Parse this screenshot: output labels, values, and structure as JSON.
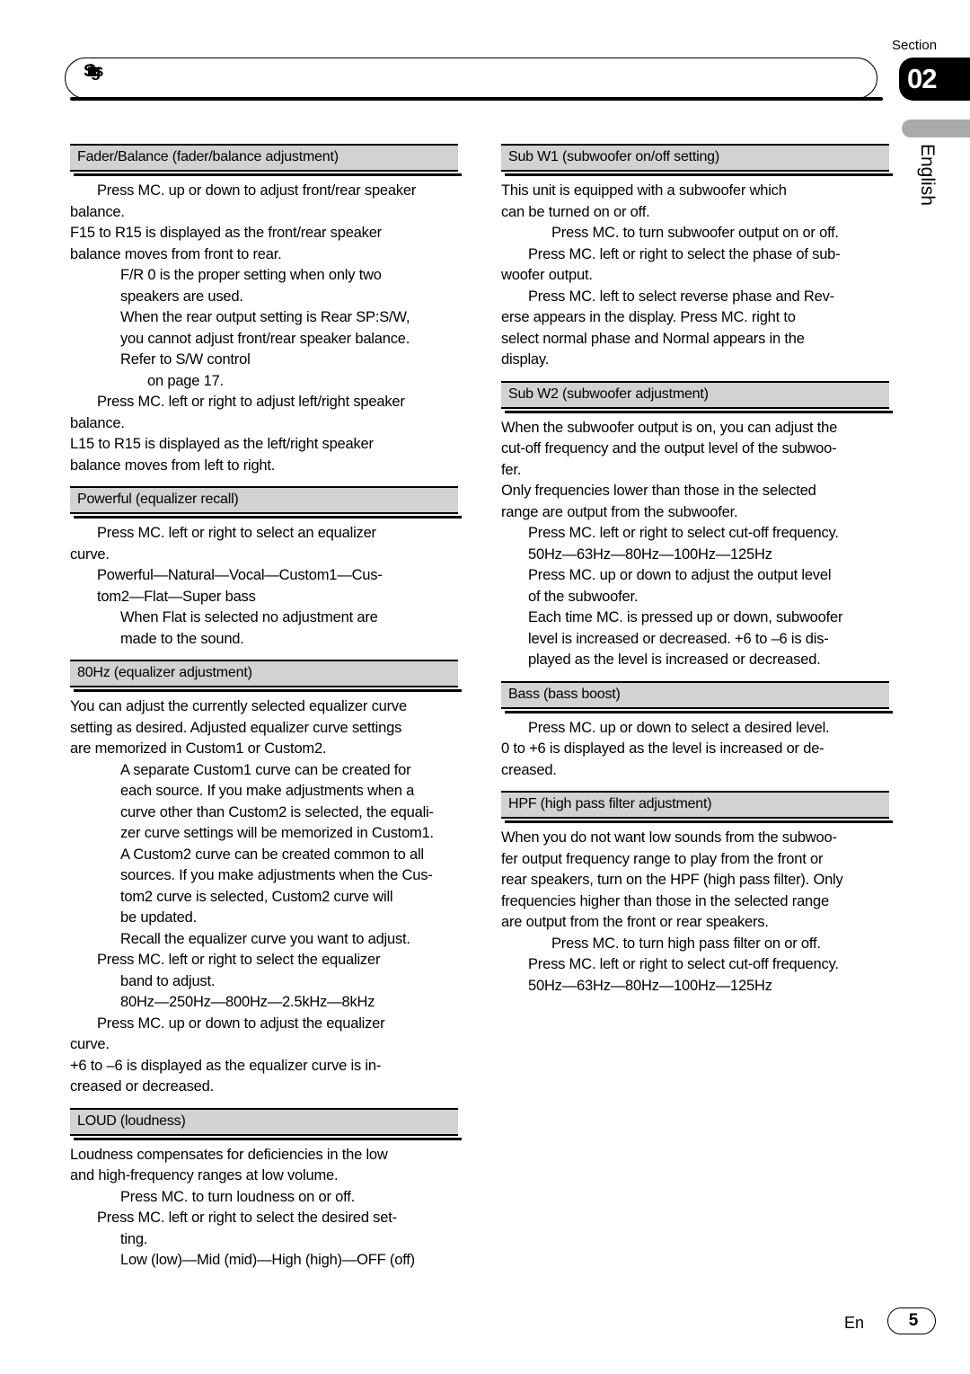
{
  "page": {
    "header_title": "Settings",
    "section_label": "Section",
    "section_number": "02",
    "language_tab": "English",
    "footer_lang": "En",
    "footer_page": "5"
  },
  "left_column": [
    {
      "heading": "Fader/Balance (fader/balance adjustment)",
      "lines": [
        {
          "indent": 1,
          "text": "Press MC. up or down to adjust front/rear speaker"
        },
        {
          "indent": 0,
          "text": "balance."
        },
        {
          "indent": 0,
          "text": "F15 to R15 is displayed as the front/rear speaker"
        },
        {
          "indent": 0,
          "text": "balance moves from front to rear."
        },
        {
          "indent": 2,
          "text": "F/R 0 is the proper setting when only two"
        },
        {
          "indent": 2,
          "text": "speakers are used."
        },
        {
          "indent": 2,
          "text": "When the rear output setting is Rear SP:S/W,"
        },
        {
          "indent": 2,
          "text": "you cannot adjust front/rear speaker balance."
        },
        {
          "indent": 2,
          "text": "Refer to S/W control"
        },
        {
          "indent": 3,
          "text": "on page 17."
        },
        {
          "indent": 1,
          "text": "Press MC. left or right to adjust left/right speaker"
        },
        {
          "indent": 0,
          "text": "balance."
        },
        {
          "indent": 0,
          "text": "L15 to R15 is displayed as the left/right speaker"
        },
        {
          "indent": 0,
          "text": "balance moves from left to right."
        }
      ]
    },
    {
      "heading": "Powerful (equalizer recall)",
      "lines": [
        {
          "indent": 1,
          "text": "Press MC. left or right to select an equalizer"
        },
        {
          "indent": 0,
          "text": "curve."
        },
        {
          "indent": 1,
          "text": "Powerful—Natural—Vocal—Custom1—Cus-"
        },
        {
          "indent": 1,
          "text": "tom2—Flat—Super bass"
        },
        {
          "indent": 2,
          "text": "When Flat is selected no adjustment are"
        },
        {
          "indent": 2,
          "text": "made to the sound."
        }
      ]
    },
    {
      "heading": "80Hz (equalizer adjustment)",
      "lines": [
        {
          "indent": 0,
          "text": "You can adjust the currently selected equalizer curve"
        },
        {
          "indent": 0,
          "text": "setting as desired. Adjusted equalizer curve settings"
        },
        {
          "indent": 0,
          "text": "are memorized in Custom1 or Custom2."
        },
        {
          "indent": 2,
          "text": "A separate Custom1 curve can be created for"
        },
        {
          "indent": 2,
          "text": "each source. If you make adjustments when a"
        },
        {
          "indent": 2,
          "text": "curve other than Custom2 is selected, the equali-"
        },
        {
          "indent": 2,
          "text": "zer curve settings will be memorized in Custom1."
        },
        {
          "indent": 2,
          "text": "A Custom2 curve can be created common to all"
        },
        {
          "indent": 2,
          "text": "sources. If you make adjustments when the Cus-"
        },
        {
          "indent": 2,
          "text": "tom2 curve is selected, Custom2 curve will"
        },
        {
          "indent": 2,
          "text": "be updated."
        },
        {
          "indent": 2,
          "text": "Recall the equalizer curve you want to adjust."
        },
        {
          "indent": 1,
          "text": "Press MC. left or right to select the equalizer"
        },
        {
          "indent": 2,
          "text": "band to adjust."
        },
        {
          "indent": 2,
          "text": "80Hz—250Hz—800Hz—2.5kHz—8kHz"
        },
        {
          "indent": 1,
          "text": "Press MC. up or down to adjust the equalizer"
        },
        {
          "indent": 0,
          "text": "curve."
        },
        {
          "indent": 0,
          "text": "+6 to –6 is displayed as the equalizer curve is in-"
        },
        {
          "indent": 0,
          "text": "creased or decreased."
        }
      ]
    },
    {
      "heading": "LOUD (loudness)",
      "lines": [
        {
          "indent": 0,
          "text": "Loudness compensates for deficiencies in the low"
        },
        {
          "indent": 0,
          "text": "and high-frequency ranges at low volume."
        },
        {
          "indent": 2,
          "text": "Press MC. to turn loudness on or off."
        },
        {
          "indent": 1,
          "text": "Press MC. left or right to select the desired set-"
        },
        {
          "indent": 2,
          "text": "ting."
        },
        {
          "indent": 2,
          "text": "Low (low)—Mid (mid)—High (high)—OFF (off)"
        }
      ]
    }
  ],
  "right_column": [
    {
      "heading": "Sub W1 (subwoofer on/off setting)",
      "lines": [
        {
          "indent": 0,
          "text": "This unit is equipped with a subwoofer which"
        },
        {
          "indent": 0,
          "text": "can be turned on or off."
        },
        {
          "indent": 2,
          "text": "Press MC. to turn subwoofer output on or off."
        },
        {
          "indent": 1,
          "text": "Press MC. left or right to select the phase of sub-"
        },
        {
          "indent": 0,
          "text": "woofer output."
        },
        {
          "indent": 1,
          "text": "Press MC. left to select reverse phase and Rev-"
        },
        {
          "indent": 0,
          "text": "erse appears in the display. Press MC. right to"
        },
        {
          "indent": 0,
          "text": "select normal phase and Normal appears in the"
        },
        {
          "indent": 0,
          "text": "display."
        }
      ]
    },
    {
      "heading": "Sub W2 (subwoofer adjustment)",
      "lines": [
        {
          "indent": 0,
          "text": "When the subwoofer output is on, you can adjust the"
        },
        {
          "indent": 0,
          "text": "cut-off frequency and the output level of the subwoo-"
        },
        {
          "indent": 0,
          "text": "fer."
        },
        {
          "indent": 0,
          "text": "Only frequencies lower than those in the selected"
        },
        {
          "indent": 0,
          "text": "range are output from the subwoofer."
        },
        {
          "indent": 1,
          "text": "Press MC. left or right to select cut-off frequency."
        },
        {
          "indent": 1,
          "text": "50Hz—63Hz—80Hz—100Hz—125Hz"
        },
        {
          "indent": 1,
          "text": "Press MC. up or down to adjust the output level"
        },
        {
          "indent": 1,
          "text": "of the subwoofer."
        },
        {
          "indent": 1,
          "text": "Each time MC. is pressed up or down, subwoofer"
        },
        {
          "indent": 1,
          "text": "level is increased or decreased. +6 to –6 is dis-"
        },
        {
          "indent": 1,
          "text": "played as the level is increased or decreased."
        }
      ]
    },
    {
      "heading": "Bass (bass boost)",
      "lines": [
        {
          "indent": 1,
          "text": "Press MC. up or down to select a desired level."
        },
        {
          "indent": 0,
          "text": "0 to +6 is displayed as the level is increased or de-"
        },
        {
          "indent": 0,
          "text": "creased."
        }
      ]
    },
    {
      "heading": "HPF (high pass filter adjustment)",
      "lines": [
        {
          "indent": 0,
          "text": "When you do not want low sounds from the subwoo-"
        },
        {
          "indent": 0,
          "text": "fer output frequency range to play from the front or"
        },
        {
          "indent": 0,
          "text": "rear speakers, turn on the HPF (high pass filter). Only"
        },
        {
          "indent": 0,
          "text": "frequencies higher than those in the selected range"
        },
        {
          "indent": 0,
          "text": "are output from the front or rear speakers."
        },
        {
          "indent": 2,
          "text": "Press MC. to turn high pass filter on or off."
        },
        {
          "indent": 1,
          "text": "Press MC. left or right to select cut-off frequency."
        },
        {
          "indent": 1,
          "text": "50Hz—63Hz—80Hz—100Hz—125Hz"
        }
      ]
    }
  ]
}
